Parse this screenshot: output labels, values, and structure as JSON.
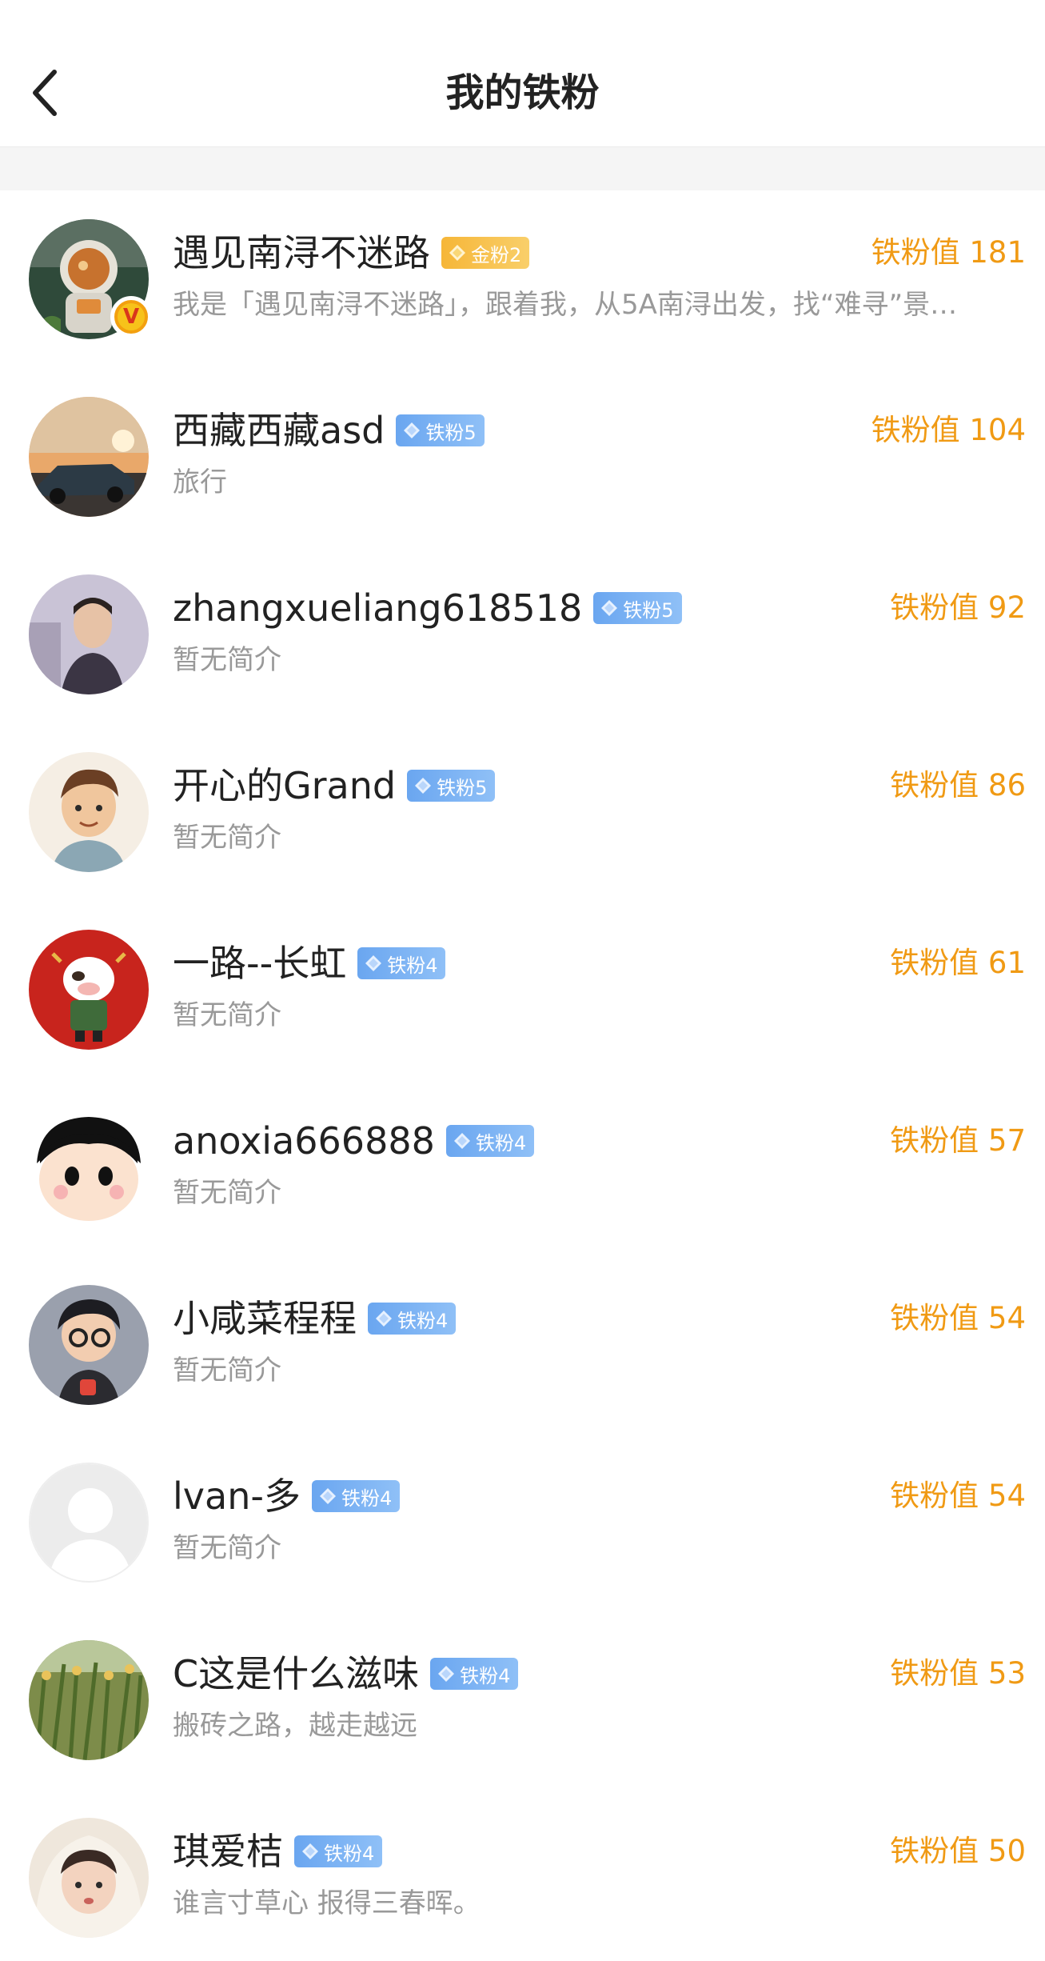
{
  "header": {
    "title": "我的铁粉",
    "back_icon": "chevron-left-icon"
  },
  "colors": {
    "fan_value": "#f09a14",
    "badge_blue": "#6aa6f0",
    "badge_gold": "#f6b638",
    "bio_gray": "#999999"
  },
  "fans": [
    {
      "name": "遇见南浔不迷路",
      "badge": "金粉2",
      "badge_type": "gold",
      "bio": "我是「遇见南浔不迷路」，跟着我，从5A南浔出发，找“难寻”景…",
      "value_text": "铁粉值 181",
      "verified": true,
      "verified_mark": "V"
    },
    {
      "name": "西藏西藏asd",
      "badge": "铁粉5",
      "badge_type": "blue",
      "bio": "旅行",
      "value_text": "铁粉值 104",
      "verified": false
    },
    {
      "name": "zhangxueliang618518",
      "badge": "铁粉5",
      "badge_type": "blue",
      "bio": "暂无简介",
      "value_text": "铁粉值 92",
      "verified": false
    },
    {
      "name": "开心的Grand",
      "badge": "铁粉5",
      "badge_type": "blue",
      "bio": "暂无简介",
      "value_text": "铁粉值 86",
      "verified": false
    },
    {
      "name": "一路--长虹",
      "badge": "铁粉4",
      "badge_type": "blue",
      "bio": "暂无简介",
      "value_text": "铁粉值 61",
      "verified": false
    },
    {
      "name": "anoxia666888",
      "badge": "铁粉4",
      "badge_type": "blue",
      "bio": "暂无简介",
      "value_text": "铁粉值 57",
      "verified": false
    },
    {
      "name": "小咸菜程程",
      "badge": "铁粉4",
      "badge_type": "blue",
      "bio": "暂无简介",
      "value_text": "铁粉值 54",
      "verified": false
    },
    {
      "name": "lvan-多",
      "badge": "铁粉4",
      "badge_type": "blue",
      "bio": "暂无简介",
      "value_text": "铁粉值 54",
      "verified": false
    },
    {
      "name": "C这是什么滋味",
      "badge": "铁粉4",
      "badge_type": "blue",
      "bio": "搬砖之路，越走越远",
      "value_text": "铁粉值 53",
      "verified": false
    },
    {
      "name": "琪爱桔",
      "badge": "铁粉4",
      "badge_type": "blue",
      "bio": "谁言寸草心 报得三春晖。",
      "value_text": "铁粉值 50",
      "verified": false
    }
  ]
}
